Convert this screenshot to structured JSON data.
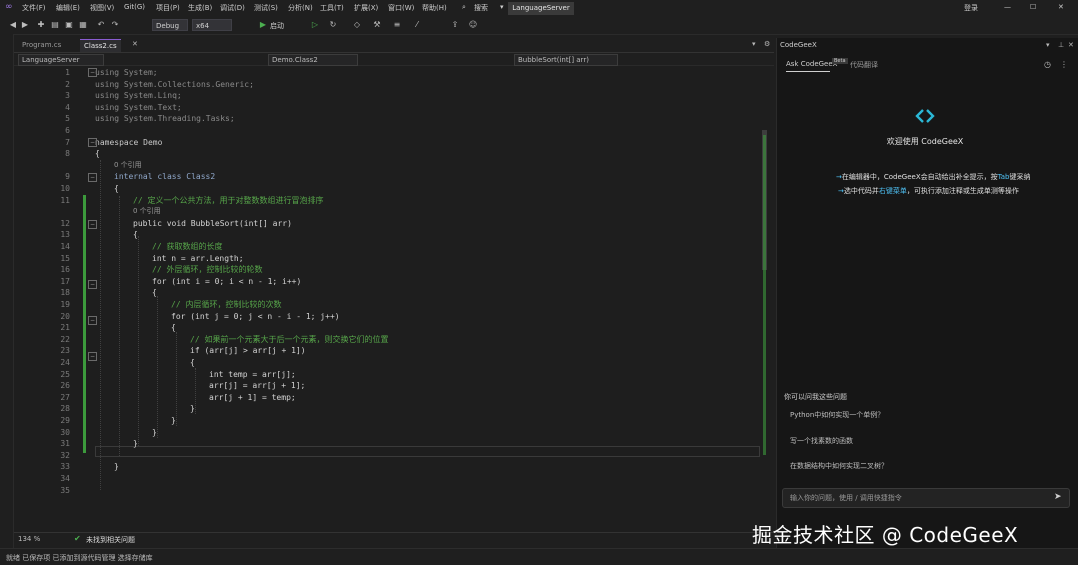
{
  "menu": {
    "items": [
      "文件(F)",
      "编辑(E)",
      "视图(V)",
      "Git(G)",
      "项目(P)",
      "生成(B)",
      "调试(D)",
      "测试(S)",
      "分析(N)",
      "工具(T)",
      "扩展(X)",
      "窗口(W)",
      "帮助(H)",
      "搜索",
      "LanguageServer"
    ],
    "user": "登录"
  },
  "toolbar": {
    "config": "Debug",
    "platform": "x64",
    "start_label": "启动"
  },
  "tabs": [
    "Program.cs",
    "Class2.cs"
  ],
  "nav": {
    "project": "LanguageServer",
    "class": "Demo.Class2",
    "member": "BubbleSort(int[] arr)"
  },
  "code_lines": [
    {
      "n": "1",
      "t": "using System;"
    },
    {
      "n": "2",
      "t": "using System.Collections.Generic;"
    },
    {
      "n": "3",
      "t": "using System.Linq;"
    },
    {
      "n": "4",
      "t": "using System.Text;"
    },
    {
      "n": "5",
      "t": "using System.Threading.Tasks;"
    },
    {
      "n": "6",
      "t": ""
    },
    {
      "n": "7",
      "t": "namespace Demo"
    },
    {
      "n": "8",
      "t": "{"
    },
    {
      "n": "",
      "t": "0 个引用"
    },
    {
      "n": "9",
      "t": "internal class Class2"
    },
    {
      "n": "10",
      "t": "{"
    },
    {
      "n": "11",
      "t": "// 定义一个公共方法，用于对整数数组进行冒泡排序"
    },
    {
      "n": "",
      "t": "0 个引用"
    },
    {
      "n": "12",
      "t": "public void BubbleSort(int[] arr)"
    },
    {
      "n": "13",
      "t": "{"
    },
    {
      "n": "14",
      "t": "// 获取数组的长度"
    },
    {
      "n": "15",
      "t": "int n = arr.Length;"
    },
    {
      "n": "16",
      "t": "// 外层循环，控制比较的轮数"
    },
    {
      "n": "17",
      "t": "for (int i = 0; i < n - 1; i++)"
    },
    {
      "n": "18",
      "t": "{"
    },
    {
      "n": "19",
      "t": "// 内层循环，控制比较的次数"
    },
    {
      "n": "20",
      "t": "for (int j = 0; j < n - i - 1; j++)"
    },
    {
      "n": "21",
      "t": "{"
    },
    {
      "n": "22",
      "t": "// 如果前一个元素大于后一个元素，则交换它们的位置"
    },
    {
      "n": "23",
      "t": "if (arr[j] > arr[j + 1])"
    },
    {
      "n": "24",
      "t": "{"
    },
    {
      "n": "25",
      "t": "int temp = arr[j];"
    },
    {
      "n": "26",
      "t": "arr[j] = arr[j + 1];"
    },
    {
      "n": "27",
      "t": "arr[j + 1] = temp;"
    },
    {
      "n": "28",
      "t": "}"
    },
    {
      "n": "29",
      "t": "}"
    },
    {
      "n": "30",
      "t": "}"
    },
    {
      "n": "31",
      "t": "}"
    },
    {
      "n": "32",
      "t": ""
    },
    {
      "n": "33",
      "t": "}"
    },
    {
      "n": "34",
      "t": ""
    },
    {
      "n": "35",
      "t": ""
    }
  ],
  "editor_status": {
    "zoom": "134 %",
    "issues": "未找到相关问题"
  },
  "statusbar": {
    "left": "就绪  已保存项  已添加到源代码管理  选择存储库"
  },
  "panel": {
    "title": "CodeGeeX",
    "tab_ask": "Ask CodeGeeX",
    "tab_beta": "Beta",
    "tab_history": "代码翻译",
    "welcome": "欢迎使用 CodeGeeX",
    "tip1_pre": "在编辑器中，CodeGeeX会自动给出补全提示，按",
    "tip1_key": "Tab",
    "tip1_post": "键采纳",
    "tip2_pre": "选中代码并",
    "tip2_key": "右键菜单",
    "tip2_post": "，可执行添加注释或生成单测等操作",
    "ask_label": "你可以问我这些问题",
    "suggestions": [
      "Python中如何实现一个单例？",
      "写一个找素数的函数",
      "在数据结构中如何实现二叉树？"
    ],
    "chat_placeholder": "输入你的问题，使用 / 调用快捷指令"
  },
  "watermark": "掘金技术社区 @ CodeGeeX",
  "colors": {
    "accent": "#8a5cd1",
    "change_bar": "#3c9a3c",
    "link": "#4fc3f7"
  }
}
